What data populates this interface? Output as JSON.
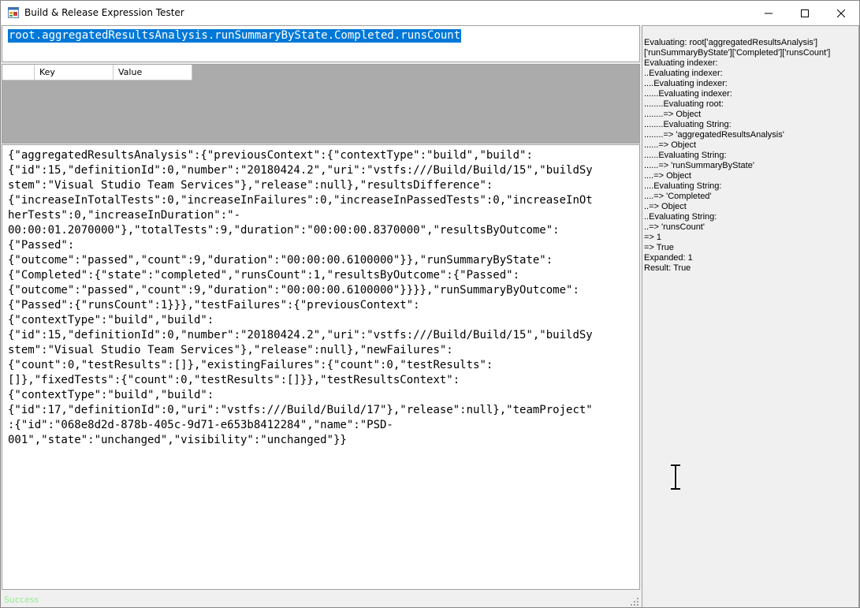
{
  "window": {
    "title": "Build & Release Expression Tester"
  },
  "expression": {
    "value": "root.aggregatedResultsAnalysis.runSummaryByState.Completed.runsCount"
  },
  "grid": {
    "columns": [
      "",
      "Key",
      "Value"
    ]
  },
  "json_output": {
    "lines": [
      "{\"aggregatedResultsAnalysis\":{\"previousContext\":{\"contextType\":\"build\",\"build\":",
      "{\"id\":15,\"definitionId\":0,\"number\":\"20180424.2\",\"uri\":\"vstfs:///Build/Build/15\",\"buildSy",
      "stem\":\"Visual Studio Team Services\"},\"release\":null},\"resultsDifference\":",
      "{\"increaseInTotalTests\":0,\"increaseInFailures\":0,\"increaseInPassedTests\":0,\"increaseInOt",
      "herTests\":0,\"increaseInDuration\":\"-",
      "00:00:01.2070000\"},\"totalTests\":9,\"duration\":\"00:00:00.8370000\",\"resultsByOutcome\":",
      "{\"Passed\":",
      "{\"outcome\":\"passed\",\"count\":9,\"duration\":\"00:00:00.6100000\"}},\"runSummaryByState\":",
      "{\"Completed\":{\"state\":\"completed\",\"runsCount\":1,\"resultsByOutcome\":{\"Passed\":",
      "{\"outcome\":\"passed\",\"count\":9,\"duration\":\"00:00:00.6100000\"}}}},\"runSummaryByOutcome\":",
      "{\"Passed\":{\"runsCount\":1}}},\"testFailures\":{\"previousContext\":",
      "{\"contextType\":\"build\",\"build\":",
      "{\"id\":15,\"definitionId\":0,\"number\":\"20180424.2\",\"uri\":\"vstfs:///Build/Build/15\",\"buildSy",
      "stem\":\"Visual Studio Team Services\"},\"release\":null},\"newFailures\":",
      "{\"count\":0,\"testResults\":[]},\"existingFailures\":{\"count\":0,\"testResults\":",
      "[]},\"fixedTests\":{\"count\":0,\"testResults\":[]}},\"testResultsContext\":",
      "{\"contextType\":\"build\",\"build\":",
      "{\"id\":17,\"definitionId\":0,\"uri\":\"vstfs:///Build/Build/17\"},\"release\":null},\"teamProject\"",
      ":{\"id\":\"068e8d2d-878b-405c-9d71-e653b8412284\",\"name\":\"PSD-",
      "001\",\"state\":\"unchanged\",\"visibility\":\"unchanged\"}}"
    ]
  },
  "status": {
    "text": "Success",
    "color": "#90ee90"
  },
  "log": {
    "lines": [
      "Evaluating: root['aggregatedResultsAnalysis']",
      "['runSummaryByState']['Completed']['runsCount']",
      "Evaluating indexer:",
      "..Evaluating indexer:",
      "....Evaluating indexer:",
      "......Evaluating indexer:",
      "........Evaluating root:",
      "........=> Object",
      "........Evaluating String:",
      "........=> 'aggregatedResultsAnalysis'",
      "......=> Object",
      "......Evaluating String:",
      "......=> 'runSummaryByState'",
      "....=> Object",
      "....Evaluating String:",
      "....=> 'Completed'",
      "..=> Object",
      "..Evaluating String:",
      "..=> 'runsCount'",
      "=> 1",
      "=> True",
      "Expanded: 1",
      "Result: True"
    ]
  },
  "colors": {
    "selection": "#0078d7",
    "grid_background": "#ababab"
  }
}
